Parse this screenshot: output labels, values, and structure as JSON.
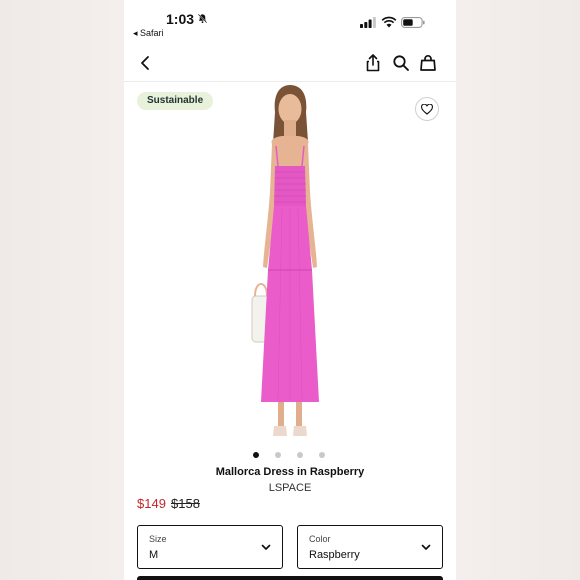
{
  "status_bar": {
    "time": "1:03",
    "back_app": "◂ Safari"
  },
  "icons": {
    "bell": "bell-slash-icon",
    "signal": "cellular-signal-icon",
    "wifi": "wifi-icon",
    "battery": "battery-icon",
    "back": "chevron-left-icon",
    "share": "share-icon",
    "search": "search-icon",
    "bag": "shopping-bag-icon",
    "wishlist": "heart-icon",
    "dropdown": "chevron-down-icon"
  },
  "product": {
    "badge": "Sustainable",
    "name": "Mallorca Dress in Raspberry",
    "brand": "LSPACE",
    "sale_price": "$149",
    "original_price": "$158",
    "image_count": 4,
    "active_image": 1,
    "image_description": "pink-smocked-maxi-dress"
  },
  "options": {
    "size": {
      "label": "Size",
      "value": "M"
    },
    "color": {
      "label": "Color",
      "value": "Raspberry"
    }
  },
  "colors": {
    "sale": "#c2272d",
    "badge_bg": "#e8f1d9",
    "dress": "#ea5cc9"
  }
}
